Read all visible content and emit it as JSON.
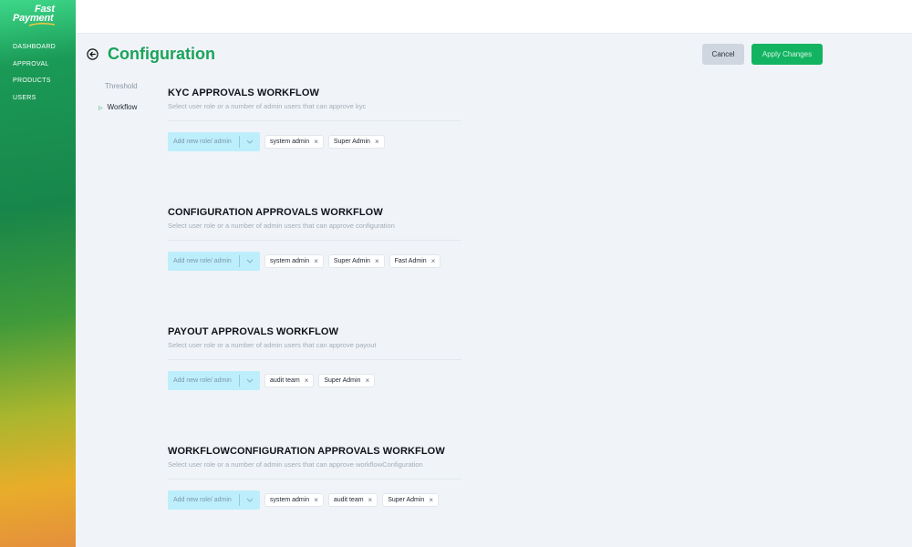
{
  "brand": {
    "line1": "Fast",
    "line2": "Payment"
  },
  "sidebar": {
    "items": [
      {
        "label": "DASHBOARD"
      },
      {
        "label": "APPROVAL"
      },
      {
        "label": "PRODUCTS"
      },
      {
        "label": "USERS"
      }
    ]
  },
  "header": {
    "title": "Configuration",
    "cancel_label": "Cancel",
    "apply_label": "Apply Changes"
  },
  "subnav": {
    "threshold": "Threshold",
    "workflow": "Workflow"
  },
  "sections": [
    {
      "title": "KYC APPROVALS WORKFLOW",
      "description": "Select user role or a number of admin users that can approve kyc",
      "placeholder": "Add new role/ admin",
      "chips": [
        "system admin",
        "Super Admin"
      ]
    },
    {
      "title": "CONFIGURATION APPROVALS WORKFLOW",
      "description": "Select user role or a number of admin users that can approve configuration",
      "placeholder": "Add new role/ admin",
      "chips": [
        "system admin",
        "Super Admin",
        "Fast Admin"
      ]
    },
    {
      "title": "PAYOUT APPROVALS WORKFLOW",
      "description": "Select user role or a number of admin users that can approve payout",
      "placeholder": "Add new role/ admin",
      "chips": [
        "audit team",
        "Super Admin"
      ]
    },
    {
      "title": "WORKFLOWCONFIGURATION APPROVALS WORKFLOW",
      "description": "Select user role or a number of admin users that can approve workflowConfiguration",
      "placeholder": "Add new role/ admin",
      "chips": [
        "system admin",
        "audit team",
        "Super Admin"
      ]
    }
  ],
  "icons": {
    "back": "arrow-left-circle-icon",
    "chip_remove": "close-icon",
    "dropdown": "chevron-down-icon",
    "subnav_active": "triangle-right-icon"
  },
  "colors": {
    "primary": "#12b461",
    "title_green": "#1aa35a",
    "select_bg": "#bdeefc",
    "page_bg": "#f0f4f8"
  }
}
